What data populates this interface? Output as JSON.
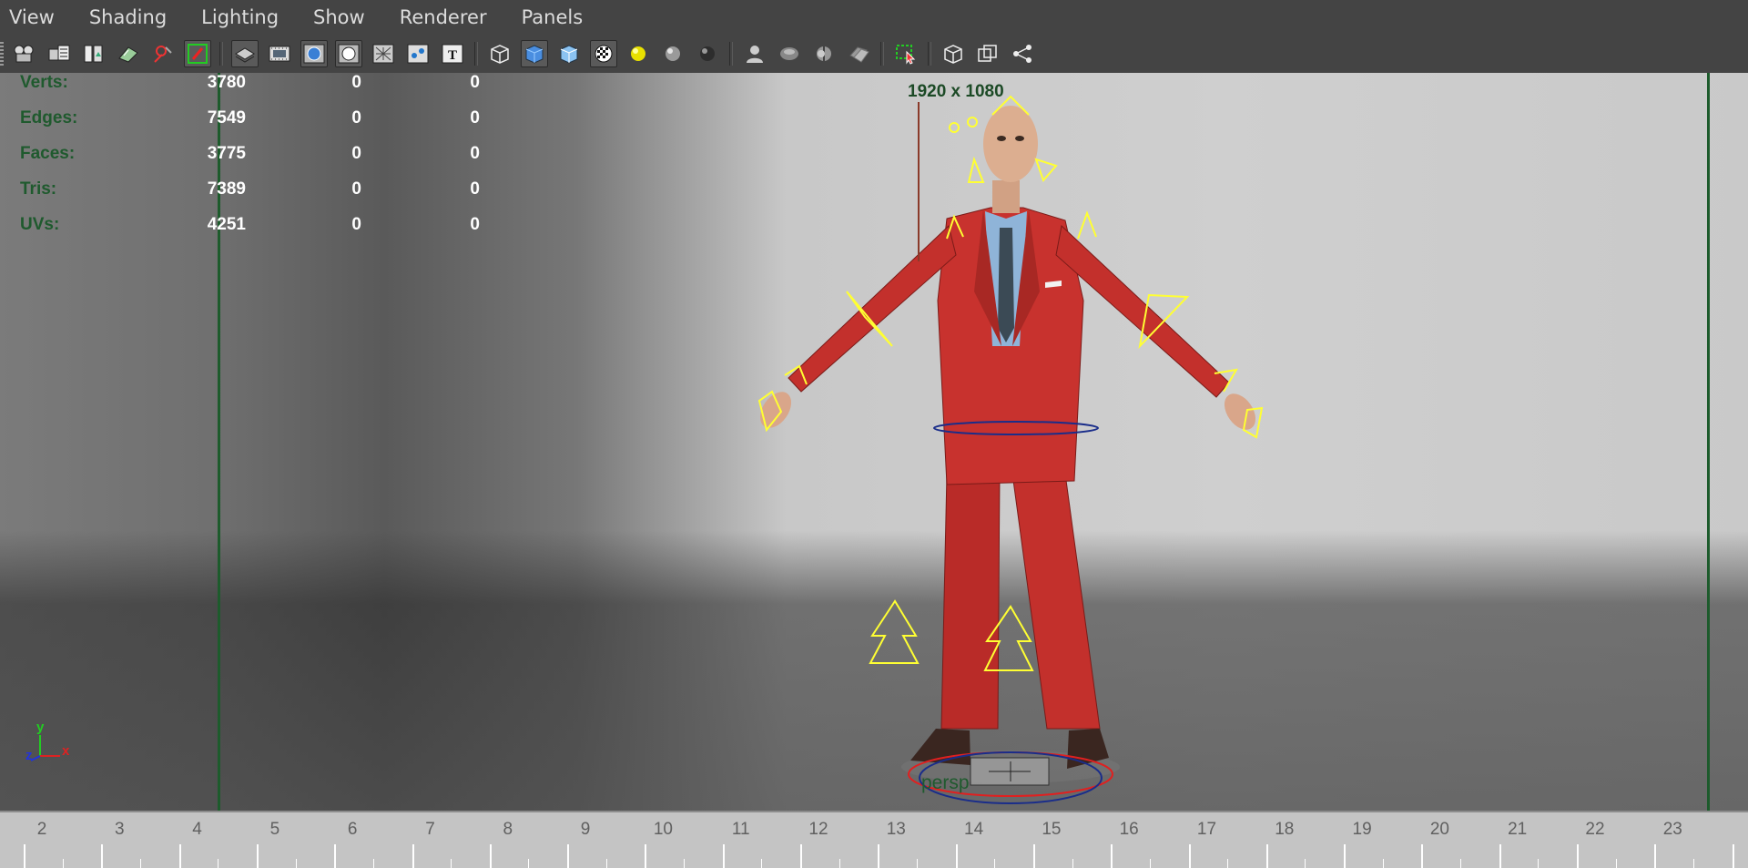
{
  "menu": [
    "View",
    "Shading",
    "Lighting",
    "Show",
    "Renderer",
    "Panels"
  ],
  "toolbar": {
    "groups": [
      [
        "camera-attributes-icon",
        "bookmarks-icon",
        "image-plane-icon",
        "2d-pan-zoom-icon",
        "grease-pencil-icon",
        "resolution-gate-icon"
      ],
      [
        "wireframe-on-shaded-icon",
        "film-gate-icon",
        "smooth-shade-icon",
        "flat-shade-icon",
        "xray-icon",
        "xray-joints-icon",
        "texture-icon"
      ],
      [
        "bounding-box-icon",
        "wireframe-icon",
        "shaded-icon",
        "textured-icon",
        "use-all-lights-icon",
        "default-light-icon",
        "shadows-icon"
      ],
      [
        "isolate-select-icon",
        "screen-space-ambient-occlusion-icon",
        "motion-blur-icon",
        "anti-aliasing-icon"
      ],
      [
        "select-camera-icon"
      ],
      [
        "gate-mask-icon",
        "field-chart-icon",
        "safe-action-icon"
      ]
    ]
  },
  "viewport": {
    "resolution_label": "1920 x 1080",
    "camera_name": "persp",
    "stats": [
      {
        "label": "Verts:",
        "v1": "3780",
        "v2": "0",
        "v3": "0"
      },
      {
        "label": "Edges:",
        "v1": "7549",
        "v2": "0",
        "v3": "0"
      },
      {
        "label": "Faces:",
        "v1": "3775",
        "v2": "0",
        "v3": "0"
      },
      {
        "label": "Tris:",
        "v1": "7389",
        "v2": "0",
        "v3": "0"
      },
      {
        "label": "UVs:",
        "v1": "4251",
        "v2": "0",
        "v3": "0"
      }
    ],
    "axis": {
      "y": "y",
      "z": "z",
      "x": "x"
    }
  },
  "timeline": {
    "labels": [
      "2",
      "3",
      "4",
      "5",
      "6",
      "7",
      "8",
      "9",
      "10",
      "11",
      "12",
      "13",
      "14",
      "15",
      "16",
      "17",
      "18",
      "19",
      "20",
      "21",
      "22",
      "23"
    ]
  },
  "colors": {
    "hud_label": "#1f5a2e",
    "hud_value": "#ffffff",
    "gate": "#1d5b2c",
    "suit": "#c8322e",
    "controls": "#ffff33"
  }
}
